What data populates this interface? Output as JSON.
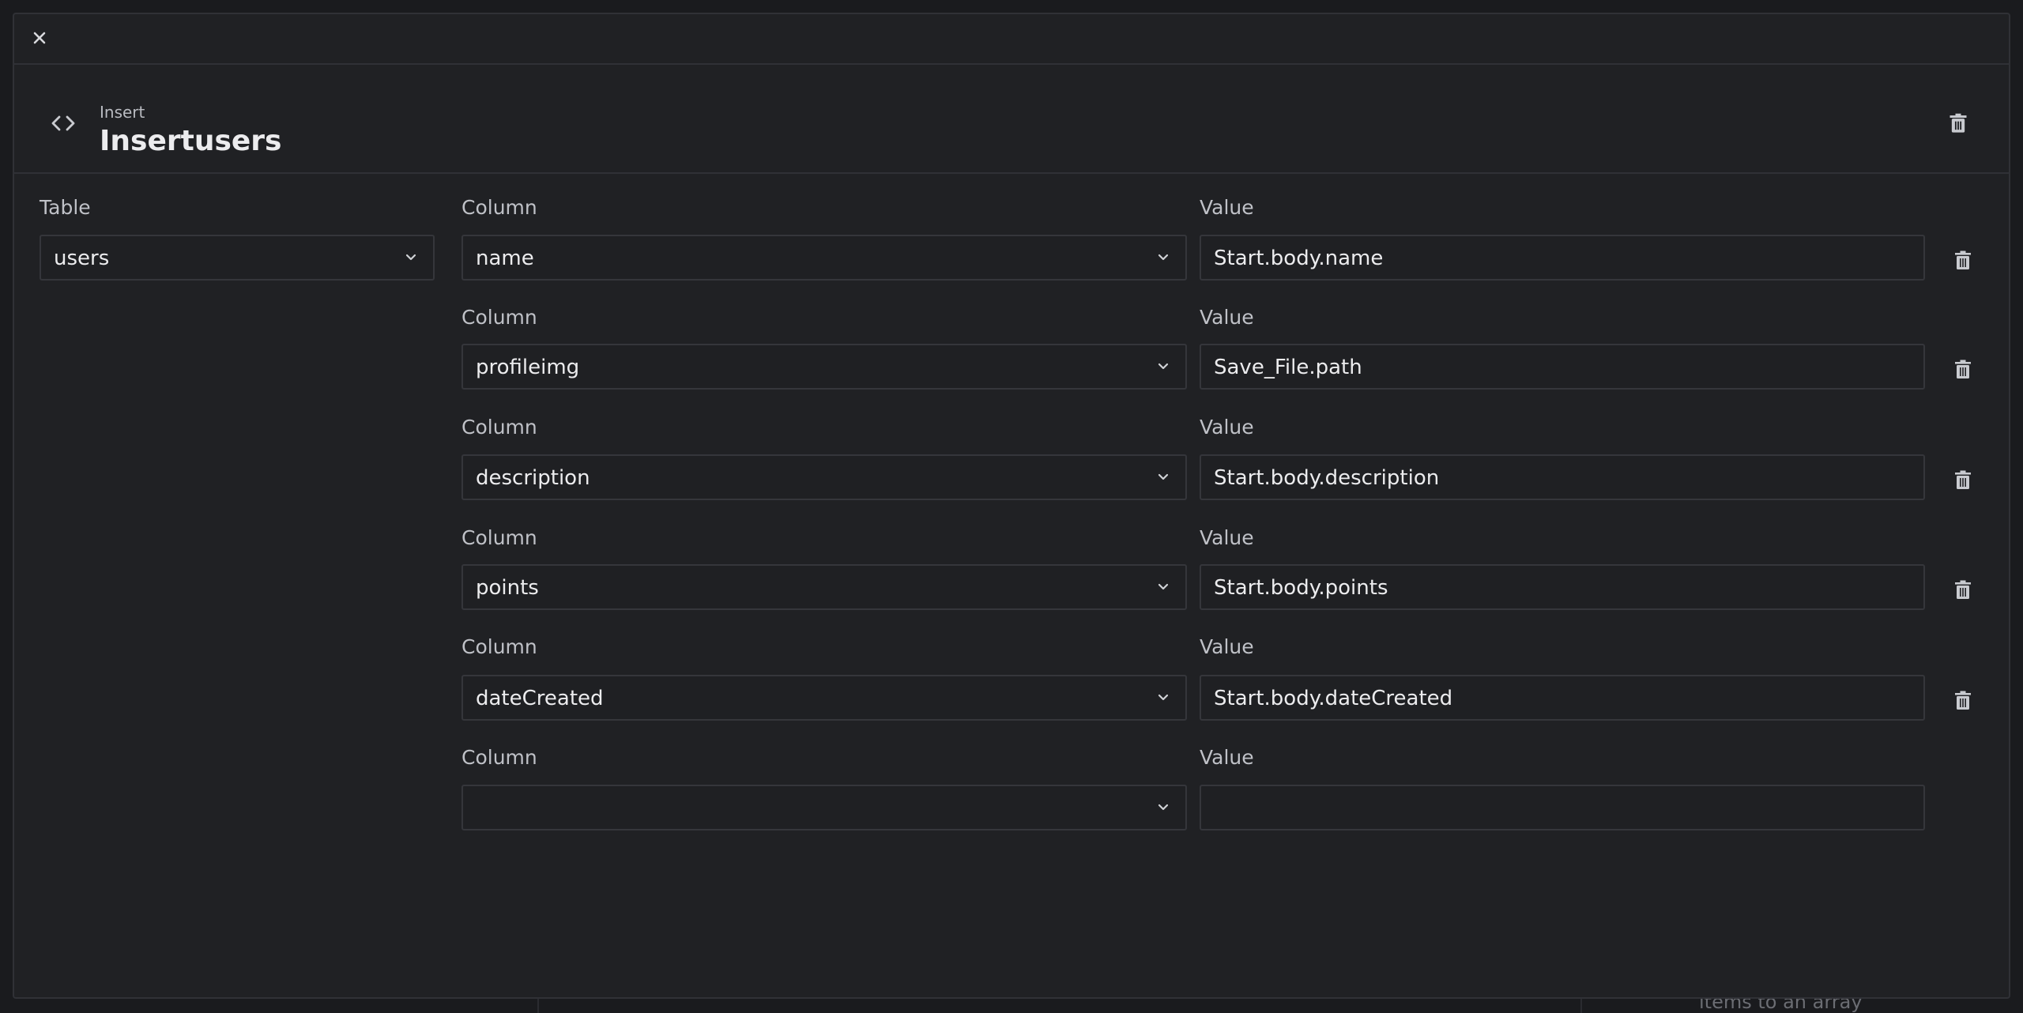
{
  "modal": {
    "header": {
      "subtitle": "Insert",
      "title": "Insertusers"
    },
    "table": {
      "label": "Table",
      "value": "users"
    },
    "column_label": "Column",
    "value_label": "Value",
    "rows": [
      {
        "column": "name",
        "value": "Start.body.name"
      },
      {
        "column": "profileimg",
        "value": "Save_File.path"
      },
      {
        "column": "description",
        "value": "Start.body.description"
      },
      {
        "column": "points",
        "value": "Start.body.points"
      },
      {
        "column": "dateCreated",
        "value": "Start.body.dateCreated"
      },
      {
        "column": "",
        "value": ""
      }
    ]
  },
  "background": {
    "hint_text": "items to an array"
  },
  "icons": {
    "close": "close-icon",
    "code": "code-icon",
    "trash": "trash-icon",
    "chevron": "chevron-down-icon"
  },
  "colors": {
    "modal_bg": "#202124",
    "border": "#303136",
    "text": "#ececee",
    "muted": "#bfc1c7"
  }
}
